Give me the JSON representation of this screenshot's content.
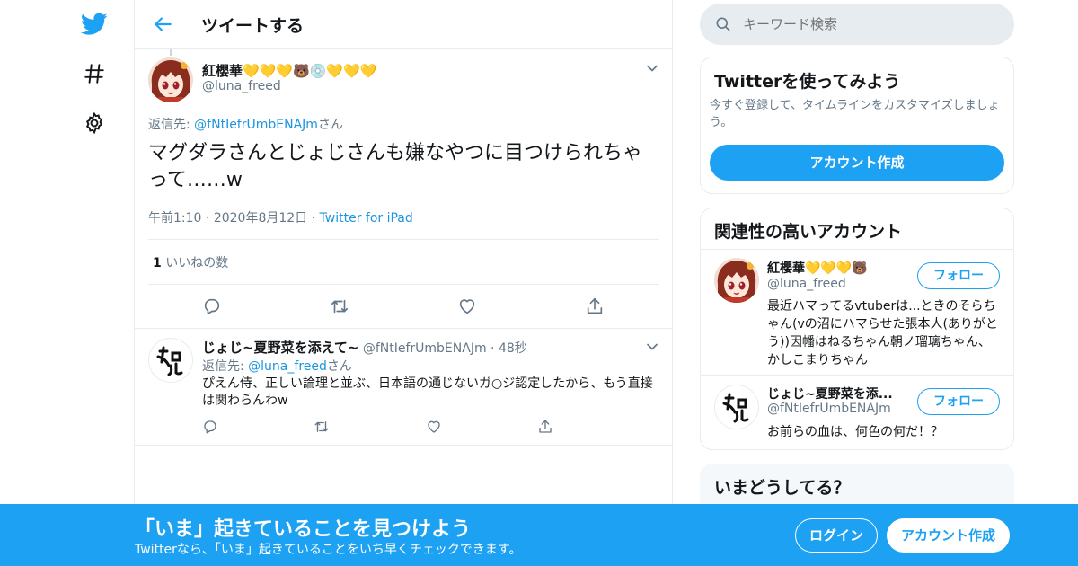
{
  "header": {
    "title": "ツイートする"
  },
  "tweet": {
    "author_name": "紅櫻華💛💛💛🐻💿💛💛💛",
    "author_handle": "@luna_freed",
    "reply_prefix": "返信先: ",
    "reply_to": "@fNtIefrUmbENAJm",
    "reply_suffix": "さん",
    "text": "マグダラさんとじょじさんも嫌なやつに目つけられちゃって……w",
    "time": "午前1:10",
    "date": "2020年8月12日",
    "source": "Twitter for iPad",
    "likes_count": "1",
    "likes_label": "いいねの数"
  },
  "reply": {
    "author_name": "じょじ~夏野菜を添えて~",
    "author_handle": "@fNtIefrUmbENAJm",
    "time_ago": "48秒",
    "reply_prefix": "返信先: ",
    "reply_to": "@luna_freed",
    "reply_suffix": "さん",
    "text": "ぴえん侍、正しい論理と並ぶ、日本語の通じないガ○ジ認定したから、もう直接は関わらんわw"
  },
  "search": {
    "placeholder": "キーワード検索"
  },
  "signup_card": {
    "title": "Twitterを使ってみよう",
    "description": "今すぐ登録して、タイムラインをカスタマイズしましょう。",
    "button": "アカウント作成"
  },
  "related": {
    "title": "関連性の高いアカウント",
    "accounts": [
      {
        "name": "紅櫻華💛💛💛🐻",
        "handle": "@luna_freed",
        "bio": "最近ハマってるvtuberは...ときのそらちゃん(vの沼にハマらせた張本人(ありがとう))因幡はねるちゃん朝ノ瑠璃ちゃん、かしこまりちゃん",
        "follow": "フォロー"
      },
      {
        "name": "じょじ~夏野菜を添...",
        "handle": "@fNtIefrUmbENAJm",
        "bio": "お前らの血は、何色の何だ！？",
        "follow": "フォロー"
      }
    ]
  },
  "trends_card": {
    "title": "いまどうしてる？"
  },
  "banner": {
    "headline": "「いま」起きていることを見つけよう",
    "subtext": "Twitterなら、「いま」起きていることをいち早くチェックできます。",
    "login": "ログイン",
    "signup": "アカウント作成"
  },
  "colors": {
    "brand": "#1da1f2",
    "link": "#1b95e0",
    "muted": "#657786",
    "border": "#e6ecf0"
  },
  "icons": [
    "twitter-bird-icon",
    "hashtag-icon",
    "gear-icon",
    "back-arrow-icon",
    "chevron-down-icon",
    "reply-icon",
    "retweet-icon",
    "like-icon",
    "share-icon",
    "search-icon"
  ]
}
